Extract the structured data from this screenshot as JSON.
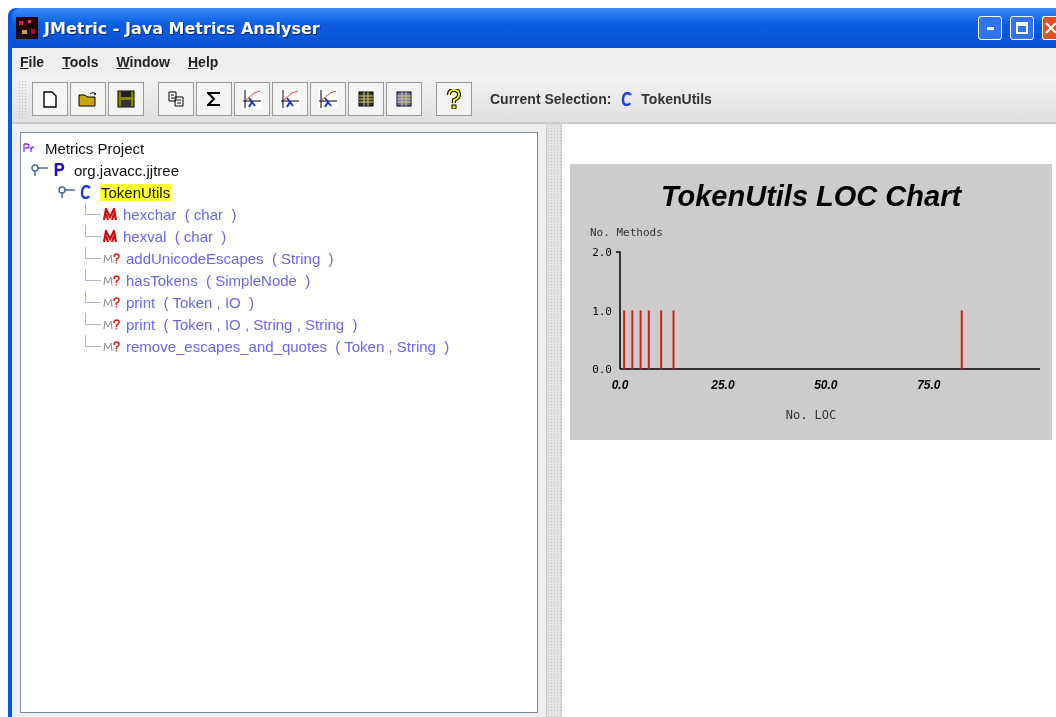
{
  "window": {
    "title": "JMetric - Java Metrics Analyser"
  },
  "menu": [
    "File",
    "Tools",
    "Window",
    "Help"
  ],
  "current_selection": {
    "label": "Current Selection:",
    "value": "TokenUtils"
  },
  "tree": [
    {
      "kind": "project",
      "label": "Metrics Project",
      "selected": false,
      "children": [
        {
          "kind": "package",
          "label": "org.javacc.jjtree",
          "selected": false,
          "expanded": true,
          "children": [
            {
              "kind": "class",
              "label": "TokenUtils",
              "selected": true,
              "expanded": true,
              "children": [
                {
                  "kind": "method",
                  "label": "hexchar  ( char  )",
                  "selected": false
                },
                {
                  "kind": "method",
                  "label": "hexval  ( char  )",
                  "selected": false
                },
                {
                  "kind": "unknown",
                  "label": "addUnicodeEscapes  ( String  )",
                  "selected": false
                },
                {
                  "kind": "unknown",
                  "label": "hasTokens  ( SimpleNode  )",
                  "selected": false
                },
                {
                  "kind": "unknown",
                  "label": "print  ( Token , IO  )",
                  "selected": false
                },
                {
                  "kind": "unknown",
                  "label": "print  ( Token , IO , String , String  )",
                  "selected": false
                },
                {
                  "kind": "unknown",
                  "label": "remove_escapes_and_quotes  ( Token , String  )",
                  "selected": false
                }
              ]
            }
          ]
        }
      ]
    }
  ],
  "chart": {
    "chart_data": {
      "type": "bar",
      "title": "TokenUtils LOC Chart",
      "xlabel": "No. LOC",
      "ylabel": "No. Methods",
      "x": [
        1,
        3,
        5,
        7,
        10,
        13,
        83
      ],
      "values": [
        1,
        1,
        1,
        1,
        1,
        1,
        1
      ],
      "xlim": [
        0,
        102
      ],
      "ylim": [
        0,
        2
      ],
      "xticks": [
        {
          "value": 0,
          "label": "0.0"
        },
        {
          "value": 25,
          "label": "25.0"
        },
        {
          "value": 50,
          "label": "50.0"
        },
        {
          "value": 75,
          "label": "75.0"
        }
      ],
      "yticks": [
        {
          "value": 0,
          "label": "0.0"
        },
        {
          "value": 1,
          "label": "1.0"
        },
        {
          "value": 2,
          "label": "2.0"
        }
      ]
    }
  }
}
